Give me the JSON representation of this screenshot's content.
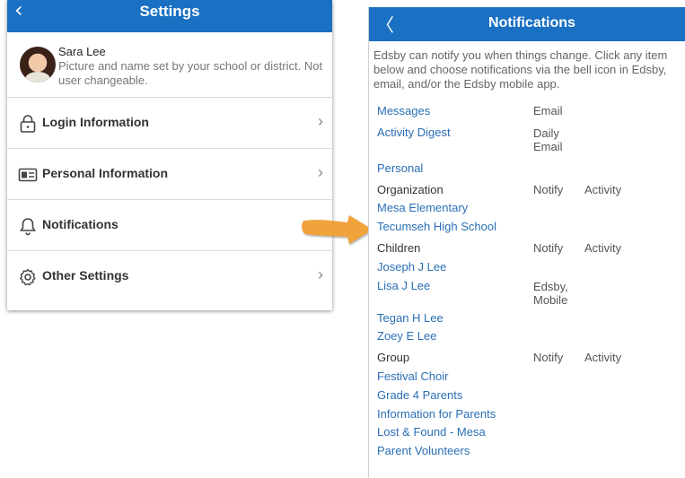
{
  "settings": {
    "title": "Settings",
    "profile": {
      "name": "Sara Lee",
      "desc": "Picture and name set by your school or district. Not user changeable."
    },
    "items": [
      {
        "label": "Login Information",
        "icon": "lock-icon"
      },
      {
        "label": "Personal Information",
        "icon": "id-card-icon"
      },
      {
        "label": "Notifications",
        "icon": "bell-icon"
      },
      {
        "label": "Other Settings",
        "icon": "gear-icon"
      }
    ]
  },
  "notifications": {
    "title": "Notifications",
    "intro": [
      "Edsby can notify you when things change. Click any item",
      "below and choose notifications via the bell icon in Edsby,",
      "email, and/or the Edsby mobile app."
    ],
    "messages": {
      "label": "Messages",
      "value": "Email"
    },
    "digest": {
      "label": "Activity Digest",
      "value": "Daily Email"
    },
    "personal": "Personal",
    "organization": {
      "label": "Organization",
      "notify": "Notify",
      "activity": "Activity"
    },
    "org_items": [
      "Mesa Elementary",
      "Tecumseh High School"
    ],
    "children": {
      "label": "Children",
      "notify": "Notify",
      "activity": "Activity"
    },
    "child_items": [
      {
        "label": "Joseph J Lee",
        "value": ""
      },
      {
        "label": "Lisa J Lee",
        "value": "Edsby, Mobile"
      },
      {
        "label": "Tegan H Lee",
        "value": ""
      },
      {
        "label": "Zoey E Lee",
        "value": ""
      }
    ],
    "group": {
      "label": "Group",
      "notify": "Notify",
      "activity": "Activity"
    },
    "group_items": [
      "Festival Choir",
      "Grade 4 Parents",
      "Information for Parents",
      "Lost & Found - Mesa",
      "Parent Volunteers"
    ]
  },
  "colors": {
    "header": "#1a70c2",
    "link": "#2a6fb5",
    "arrow": "#f0a23a"
  }
}
